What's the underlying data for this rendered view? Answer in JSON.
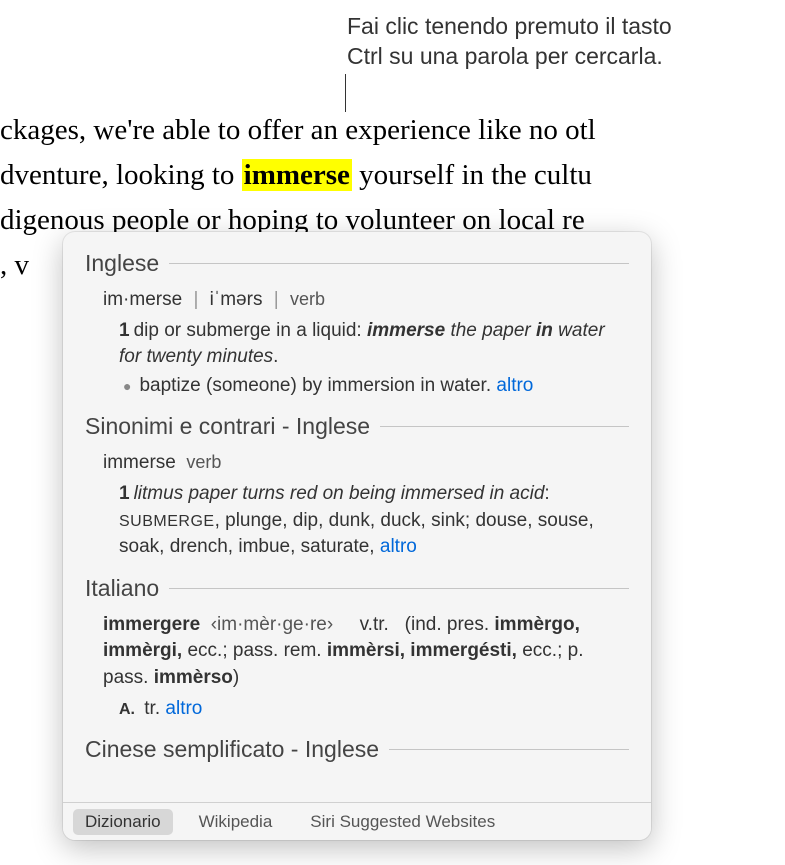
{
  "callout": {
    "line1": "Fai clic tenendo premuto il tasto",
    "line2": "Ctrl su una parola per cercarla."
  },
  "doc": {
    "line1_pre": "ckages, we're able to offer an experience like no otl",
    "line2_pre": "dventure, looking to ",
    "line2_highlight": "immerse",
    "line2_post": " yourself in the cultu",
    "line3": "digenous people or hoping to volunteer on local re",
    "line4": ", v"
  },
  "popover": {
    "sections": {
      "english": {
        "title": "Inglese",
        "headword": "im·merse",
        "pron": "iˈmərs",
        "pos": "verb",
        "def_num": "1",
        "def_text": "dip or submerge in a liquid: ",
        "example_b1": "immerse",
        "example_m": " the paper ",
        "example_b2": "in",
        "example_e": " water for twenty minutes",
        "bullet_text": "baptize (someone) by immersion in water. ",
        "more": "altro"
      },
      "thesaurus": {
        "title": "Sinonimi e contrari - Inglese",
        "headword": "immerse",
        "pos": "verb",
        "def_num": "1",
        "example": "litmus paper turns red on being immersed in acid",
        "syn_primary": "submerge",
        "syn_rest": ", plunge, dip, dunk, duck, sink; douse, souse, soak, drench, imbue, saturate, ",
        "more": "altro"
      },
      "italian": {
        "title": "Italiano",
        "headword": "immergere",
        "syll": "‹im·mèr·ge·re›",
        "pos": "v.tr.",
        "forms_pre": "(ind. pres. ",
        "forms_b1": "immèrgo, immèrgi,",
        "forms_m1": " ecc.; pass. rem. ",
        "forms_b2": "immèrsi, immergésti,",
        "forms_m2": " ecc.; p. pass. ",
        "forms_b3": "immèrso",
        "forms_end": ")",
        "sense_letter": "A.",
        "sense_text": "tr. ",
        "more": "altro"
      },
      "chinese": {
        "title": "Cinese semplificato - Inglese"
      }
    },
    "bar": {
      "dictionary": "Dizionario",
      "wikipedia": "Wikipedia",
      "siri": "Siri Suggested Websites"
    }
  }
}
